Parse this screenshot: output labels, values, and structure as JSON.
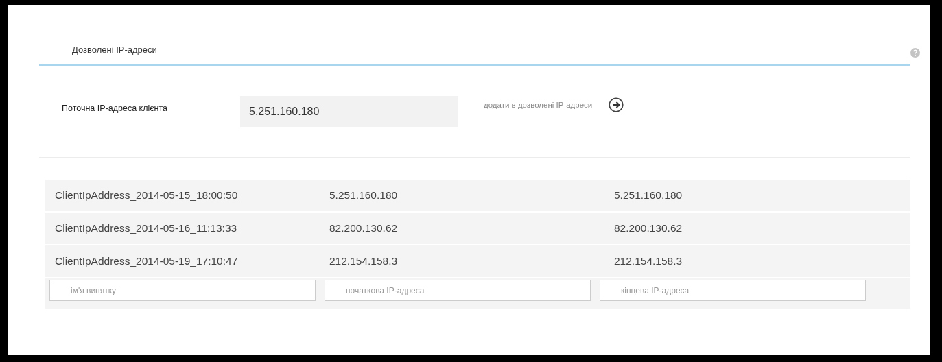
{
  "header": {
    "title": "Дозволені IP-адреси"
  },
  "current": {
    "label": "Поточна IP-адреса клієнта",
    "value": "5.251.160.180",
    "add_link": "додати в дозволені IP-адреси"
  },
  "rows": [
    {
      "name": "ClientIpAddress_2014-05-15_18:00:50",
      "start": "5.251.160.180",
      "end": "5.251.160.180"
    },
    {
      "name": "ClientIpAddress_2014-05-16_11:13:33",
      "start": "82.200.130.62",
      "end": "82.200.130.62"
    },
    {
      "name": "ClientIpAddress_2014-05-19_17:10:47",
      "start": "212.154.158.3",
      "end": "212.154.158.3"
    }
  ],
  "new_row": {
    "name_placeholder": "ім'я винятку",
    "start_placeholder": "початкова IP-адреса",
    "end_placeholder": "кінцева IP-адреса"
  }
}
